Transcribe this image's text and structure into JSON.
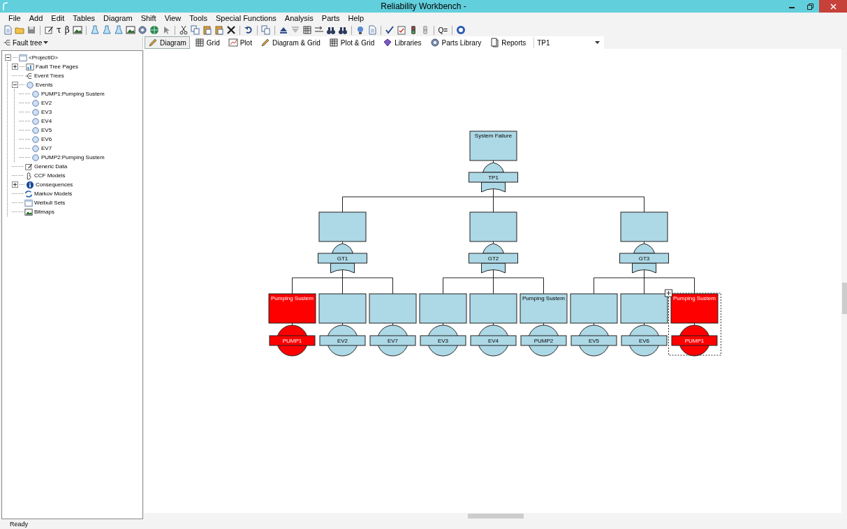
{
  "window": {
    "title": "Reliability Workbench -"
  },
  "menu": [
    "File",
    "Add",
    "Edit",
    "Tables",
    "Diagram",
    "Shift",
    "View",
    "Tools",
    "Special Functions",
    "Analysis",
    "Parts",
    "Help"
  ],
  "toolbar_glyphs": [
    "τ",
    "β",
    "Q="
  ],
  "view_selector": {
    "label": "Fault tree"
  },
  "tabs": [
    {
      "label": "Diagram",
      "selected": true
    },
    {
      "label": "Grid",
      "selected": false
    },
    {
      "label": "Plot",
      "selected": false
    },
    {
      "label": "Diagram & Grid",
      "selected": false
    },
    {
      "label": "Plot & Grid",
      "selected": false
    },
    {
      "label": "Libraries",
      "selected": false
    },
    {
      "label": "Parts Library",
      "selected": false
    },
    {
      "label": "Reports",
      "selected": false
    }
  ],
  "page_selector": {
    "value": "TP1"
  },
  "tree": [
    {
      "label": "<ProjectID>",
      "kind": "project",
      "expanded": true,
      "children": [
        {
          "label": "Fault Tree Pages",
          "kind": "pages",
          "expanded": false
        },
        {
          "label": "Event Trees",
          "kind": "event-trees"
        },
        {
          "label": "Events",
          "kind": "events",
          "expanded": true,
          "children": [
            {
              "label": "PUMP1:Pumping Sustem",
              "kind": "event"
            },
            {
              "label": "EV2",
              "kind": "event"
            },
            {
              "label": "EV3",
              "kind": "event"
            },
            {
              "label": "EV4",
              "kind": "event"
            },
            {
              "label": "EV5",
              "kind": "event"
            },
            {
              "label": "EV6",
              "kind": "event"
            },
            {
              "label": "EV7",
              "kind": "event"
            },
            {
              "label": "PUMP2:Pumping Sustem",
              "kind": "event"
            }
          ]
        },
        {
          "label": "Generic Data",
          "kind": "generic-data"
        },
        {
          "label": "CCF Models",
          "kind": "ccf"
        },
        {
          "label": "Consequences",
          "kind": "consequences",
          "expanded": false
        },
        {
          "label": "Markov Models",
          "kind": "markov"
        },
        {
          "label": "Weibull Sets",
          "kind": "weibull"
        },
        {
          "label": "Bitmaps",
          "kind": "bitmaps"
        }
      ]
    }
  ],
  "fault_tree": {
    "description": "System Failure",
    "gate": "TP1",
    "color": "#add8e6",
    "children": [
      {
        "gate": "GT1",
        "color": "#add8e6",
        "children": [
          {
            "description": "Pumping Sustem",
            "event": "PUMP1",
            "color": "#ff0000",
            "selected": false
          },
          {
            "event": "EV2",
            "color": "#add8e6",
            "selected": false
          },
          {
            "event": "EV7",
            "color": "#add8e6",
            "selected": false
          }
        ]
      },
      {
        "gate": "GT2",
        "color": "#add8e6",
        "children": [
          {
            "event": "EV3",
            "color": "#add8e6",
            "selected": false
          },
          {
            "event": "EV4",
            "color": "#add8e6",
            "selected": false
          },
          {
            "description": "Pumping Sustem",
            "event": "PUMP2",
            "color": "#add8e6",
            "selected": false
          }
        ]
      },
      {
        "gate": "GT3",
        "color": "#add8e6",
        "children": [
          {
            "event": "EV5",
            "color": "#add8e6",
            "selected": false
          },
          {
            "event": "EV6",
            "color": "#add8e6",
            "selected": false
          },
          {
            "description": "Pumping Sustem",
            "event": "PUMP1",
            "color": "#ff0000",
            "selected": true
          }
        ]
      }
    ]
  },
  "status_bar": {
    "text": "Ready"
  }
}
